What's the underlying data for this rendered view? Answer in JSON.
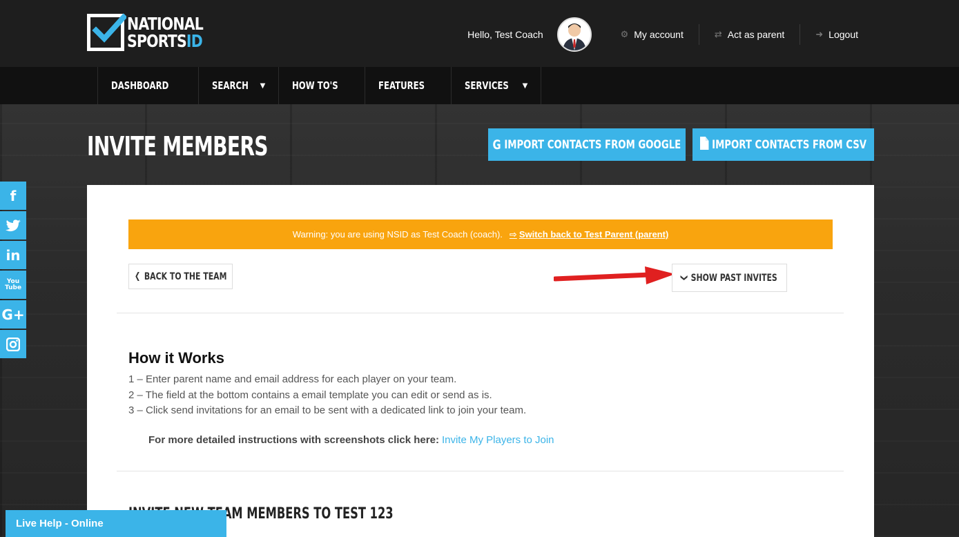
{
  "brand": {
    "line1": "NATIONAL",
    "line2a": "SPORTS",
    "line2b": "ID",
    "accent_color": "#3bb4e8"
  },
  "header": {
    "greeting": "Hello, Test Coach",
    "links": [
      {
        "label": "My account",
        "icon": "gear-icon"
      },
      {
        "label": "Act as parent",
        "icon": "swap-icon"
      },
      {
        "label": "Logout",
        "icon": "logout-icon"
      }
    ]
  },
  "nav": {
    "items": [
      {
        "label": "DASHBOARD",
        "dropdown": false
      },
      {
        "label": "SEARCH",
        "dropdown": true
      },
      {
        "label": "HOW TO'S",
        "dropdown": false
      },
      {
        "label": "FEATURES",
        "dropdown": false
      },
      {
        "label": "SERVICES",
        "dropdown": true
      }
    ]
  },
  "page": {
    "title": "INVITE MEMBERS",
    "import_google": "IMPORT CONTACTS FROM GOOGLE",
    "import_csv": "IMPORT CONTACTS FROM CSV"
  },
  "social": [
    "f",
    "t",
    "in",
    "You Tube",
    "G+",
    "ig"
  ],
  "card": {
    "warning_text": "Warning: you are using NSID as Test Coach (coach).",
    "warning_link": "Switch back to Test Parent (parent)",
    "back_button": "BACK TO THE TEAM",
    "past_invites_button": "SHOW PAST INVITES",
    "how_title": "How it Works",
    "steps": [
      "1 – Enter parent name and email address for each player on your team.",
      "2 – The field at the bottom contains a email template you can edit or send as is.",
      "3 – Click send invitations for an email to be sent with a dedicated link to join your team."
    ],
    "more_text": "For more detailed instructions with screenshots click here:",
    "more_link": "Invite My Players to Join",
    "section_title": "INVITE NEW TEAM MEMBERS TO TEST 123"
  },
  "live_help": "Live Help - Online"
}
